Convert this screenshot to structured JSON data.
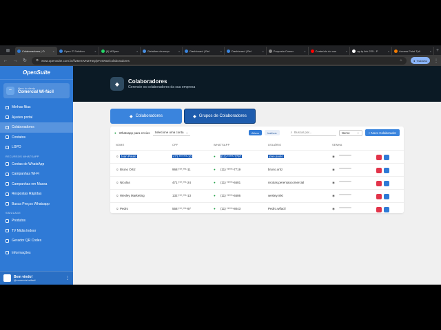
{
  "browser": {
    "tabs": [
      {
        "label": "Colaboradores | O",
        "active": true,
        "color": "#2f7ad6"
      },
      {
        "label": "Open IT Solution",
        "color": "#3a84dd"
      },
      {
        "label": "(9) WZpee",
        "color": "#25d366"
      },
      {
        "label": "Detalhes da empr",
        "color": "#4a90e2"
      },
      {
        "label": "Dashboard | Rel",
        "color": "#3a84dd"
      },
      {
        "label": "Dashboard | Rel",
        "color": "#3a84dd"
      },
      {
        "label": "Proposta Comer",
        "color": "#888888"
      },
      {
        "label": "Conteúdo do can",
        "color": "#ff0000"
      },
      {
        "label": "ap tp link 225 - P",
        "color": "#ffffff"
      },
      {
        "label": "Access Point Tpli",
        "color": "#f57c00"
      }
    ],
    "url": "www.opensuite.com.br/l/Z5eSIVNZT5Q/pFc9X0Z/colaboradores",
    "profile_label": "Trabalho"
  },
  "sidebar": {
    "logo": "OpenSuite",
    "card_caption": "Menu do cliente",
    "card_title": "Comercial Wi-fácil",
    "items_main": [
      "Minhas filias",
      "Ajustes portal",
      "Colaboradores",
      "Contatos",
      "LGPD"
    ],
    "section_whatsapp": "RECURSOS WHATSAPP",
    "items_whatsapp": [
      "Contas de WhatsApp",
      "Campanhas Wi-Fi",
      "Campanhas em Massa",
      "Respostas Rápidas",
      "Busca Preços Whatsapp"
    ],
    "section_other": "SIMULAGE",
    "items_other": [
      "Produtos",
      "TV Midia Indoor",
      "Gerador QR Codes"
    ],
    "info": "Informações",
    "footer_name": "Bem vindo!",
    "footer_sub": "@comercial.wifacil"
  },
  "header": {
    "title": "Colaboradores",
    "subtitle": "Gerencie os colaboradores da sua empresa"
  },
  "big_tabs": [
    "Colaboradores",
    "Grupos de Colaboradores"
  ],
  "toolbar": {
    "whatsapp_label": "Whatsapp para envios",
    "select_placeholder": "Selecione uma conta",
    "filter_active": "Ativos",
    "filter_inactive": "Inativos",
    "search_placeholder": "Buscar por...",
    "sort_value": "Nome",
    "new_button": "Novo Colaborador"
  },
  "table": {
    "headers": [
      "NOME",
      "CPF",
      "WHATSAPP",
      "USUÁRIO",
      "SENHA"
    ],
    "rows": [
      {
        "name": "Joan Paulo",
        "cpf": "471.***.***-10",
        "whatsapp": "(11) *****-7797",
        "user": "joao.paulo",
        "highlight": true
      },
      {
        "name": "Bruno Ortiz",
        "cpf": "968.***.***-11",
        "whatsapp": "(11) *****-7719",
        "user": "bruno.ortiz"
      },
      {
        "name": "Nicolas",
        "cpf": "471.***.***-24",
        "whatsapp": "(11) *****-6581",
        "user": "nicolas.perentaocomercial"
      },
      {
        "name": "Wesley Marketing",
        "cpf": "132.***.***-13",
        "whatsapp": "(11) *****-6586",
        "user": "wesley.mkt"
      },
      {
        "name": "Pedro",
        "cpf": "558.***.***-97",
        "whatsapp": "(11) *****-8043",
        "user": "Pedro.wifacil"
      }
    ]
  }
}
